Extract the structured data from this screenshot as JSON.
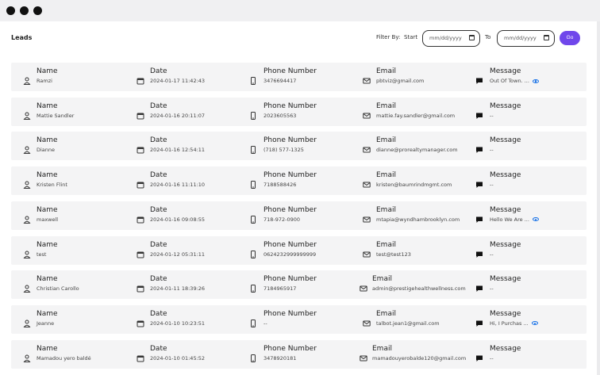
{
  "header": {
    "title": "Leads",
    "filter_label": "Filter By:",
    "start_label": "Start",
    "to_label": "To",
    "start_placeholder": "mm/dd/yyyy",
    "end_placeholder": "mm/dd/yyyy",
    "go_label": "Go"
  },
  "labels": {
    "name": "Name",
    "date": "Date",
    "phone": "Phone Number",
    "email": "Email",
    "message": "Message"
  },
  "accent": "#7047eb",
  "leads": [
    {
      "name": "Ramzi",
      "date": "2024-01-17 11:42:43",
      "phone": "3476694417",
      "email": "pbtviz@gmail.com",
      "message": "Out Of Town. ...",
      "has_view": true
    },
    {
      "name": "Mattie Sandler",
      "date": "2024-01-16 20:11:07",
      "phone": "2023605563",
      "email": "mattie.fay.sandler@gmail.com",
      "message": "--",
      "has_view": false
    },
    {
      "name": "Dianne",
      "date": "2024-01-16 12:54:11",
      "phone": "(718) 577-1325",
      "email": "dianne@prorealtymanager.com",
      "message": "--",
      "has_view": false
    },
    {
      "name": "Kristen Flint",
      "date": "2024-01-16 11:11:10",
      "phone": "7188588426",
      "email": "kristen@baumrindmgmt.com",
      "message": "--",
      "has_view": false
    },
    {
      "name": "maxwell",
      "date": "2024-01-16 09:08:55",
      "phone": "718-972-0900",
      "email": "mtapia@wyndhambrooklyn.com",
      "message": "Hello We Are ...",
      "has_view": true
    },
    {
      "name": "test",
      "date": "2024-01-12 05:31:11",
      "phone": "0624232999999999",
      "email": "test@test123",
      "message": "--",
      "has_view": false
    },
    {
      "name": "Christian Carollo",
      "date": "2024-01-11 18:39:26",
      "phone": "7184965917",
      "email": "admin@prestigehealthwellness.com",
      "message": "--",
      "has_view": false
    },
    {
      "name": "Jeanne",
      "date": "2024-01-10 10:23:51",
      "phone": "--",
      "email": "talbot.jean1@gmail.com",
      "message": "Hi, I Purchas ...",
      "has_view": true
    },
    {
      "name": "Mamadou yero baldé",
      "date": "2024-01-10 01:45:52",
      "phone": "3478920181",
      "email": "mamadouyerobalde120@gmail.com",
      "message": "--",
      "has_view": false
    }
  ]
}
